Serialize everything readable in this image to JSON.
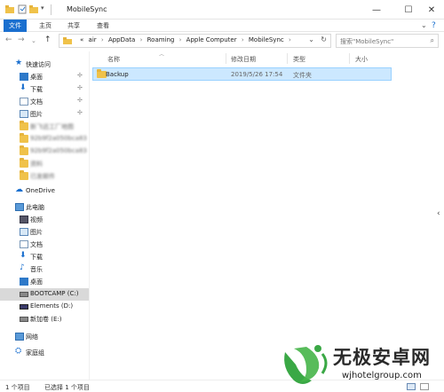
{
  "window": {
    "title": "MobileSync",
    "controls": {
      "minimize": "—",
      "maximize": "☐",
      "close": "✕"
    }
  },
  "ribbon": {
    "tabs": [
      {
        "label": "文件",
        "active": true
      },
      {
        "label": "主页",
        "active": false
      },
      {
        "label": "共享",
        "active": false
      },
      {
        "label": "查看",
        "active": false
      }
    ],
    "expand_icon": "chevron-down-icon",
    "help_icon": "question-icon"
  },
  "address": {
    "crumbs": [
      "«",
      "air",
      "AppData",
      "Roaming",
      "Apple Computer",
      "MobileSync"
    ],
    "separator": "›"
  },
  "search": {
    "placeholder": "搜索\"MobileSync\""
  },
  "sidebar": {
    "items": [
      {
        "label": "快速访问",
        "icon": "star-icon"
      },
      {
        "label": "桌面",
        "icon": "desktop-icon",
        "pinned": true
      },
      {
        "label": "下载",
        "icon": "download-icon",
        "pinned": true
      },
      {
        "label": "文档",
        "icon": "document-icon",
        "pinned": true
      },
      {
        "label": "图片",
        "icon": "picture-icon",
        "pinned": true
      },
      {
        "label": "新飞远工厂地图",
        "icon": "folder-icon",
        "blurred": true
      },
      {
        "label": "92b9f2a050bca83",
        "icon": "folder-icon",
        "blurred": true
      },
      {
        "label": "92b9f2a050bca83",
        "icon": "folder-icon",
        "blurred": true
      },
      {
        "label": "资料",
        "icon": "folder-icon",
        "blurred": true
      },
      {
        "label": "已发邮件",
        "icon": "folder-icon",
        "blurred": true
      },
      {
        "label": "OneDrive",
        "icon": "cloud-icon"
      },
      {
        "label": "此电脑",
        "icon": "computer-icon"
      },
      {
        "label": "视频",
        "icon": "video-icon"
      },
      {
        "label": "图片",
        "icon": "picture-icon"
      },
      {
        "label": "文档",
        "icon": "document-icon"
      },
      {
        "label": "下载",
        "icon": "download-icon"
      },
      {
        "label": "音乐",
        "icon": "music-icon"
      },
      {
        "label": "桌面",
        "icon": "desktop-icon"
      },
      {
        "label": "BOOTCAMP (C:)",
        "icon": "drive-icon",
        "selected": true
      },
      {
        "label": "Elements (D:)",
        "icon": "drive-icon"
      },
      {
        "label": "新加卷 (E:)",
        "icon": "drive-icon"
      },
      {
        "label": "网络",
        "icon": "network-icon"
      },
      {
        "label": "家庭组",
        "icon": "homegroup-icon"
      }
    ],
    "pin_glyph": "📌"
  },
  "columns": {
    "name": "名称",
    "date": "修改日期",
    "type": "类型",
    "size": "大小"
  },
  "files": [
    {
      "name": "Backup",
      "date": "2019/5/26 17:54",
      "type": "文件夹",
      "size": ""
    }
  ],
  "status": {
    "count": "1 个项目",
    "selected": "已选择 1 个项目"
  },
  "watermark": {
    "title": "无极安卓网",
    "url": "wjhotelgroup.com"
  },
  "colors": {
    "accent": "#1a6fcf",
    "selection": "#cce8ff",
    "folder": "#f0c24a",
    "watermark_green": "#3aa845"
  }
}
